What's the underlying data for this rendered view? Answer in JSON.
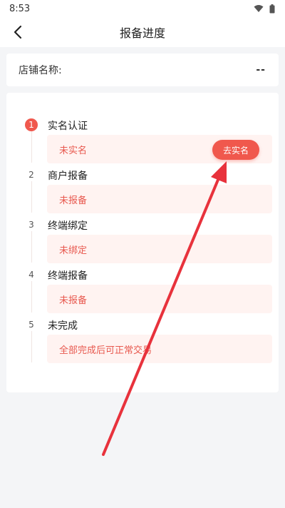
{
  "status_bar": {
    "time": "8:53"
  },
  "header": {
    "title": "报备进度"
  },
  "store": {
    "label": "店铺名称:",
    "value": "--"
  },
  "steps": [
    {
      "num": "1",
      "title": "实名认证",
      "status": "未实名"
    },
    {
      "num": "2",
      "title": "商户报备",
      "status": "未报备"
    },
    {
      "num": "3",
      "title": "终端绑定",
      "status": "未绑定"
    },
    {
      "num": "4",
      "title": "终端报备",
      "status": "未报备"
    },
    {
      "num": "5",
      "title": "未完成",
      "status": "全部完成后可正常交易"
    }
  ],
  "action_button": {
    "label": "去实名"
  },
  "colors": {
    "accent": "#f0584d",
    "status_text": "#e8594f",
    "box_bg": "#fff3f1",
    "annotation_arrow": "#e8323c"
  },
  "icons": {
    "back": "back-arrow-icon",
    "wifi": "wifi-icon",
    "battery": "battery-icon"
  }
}
